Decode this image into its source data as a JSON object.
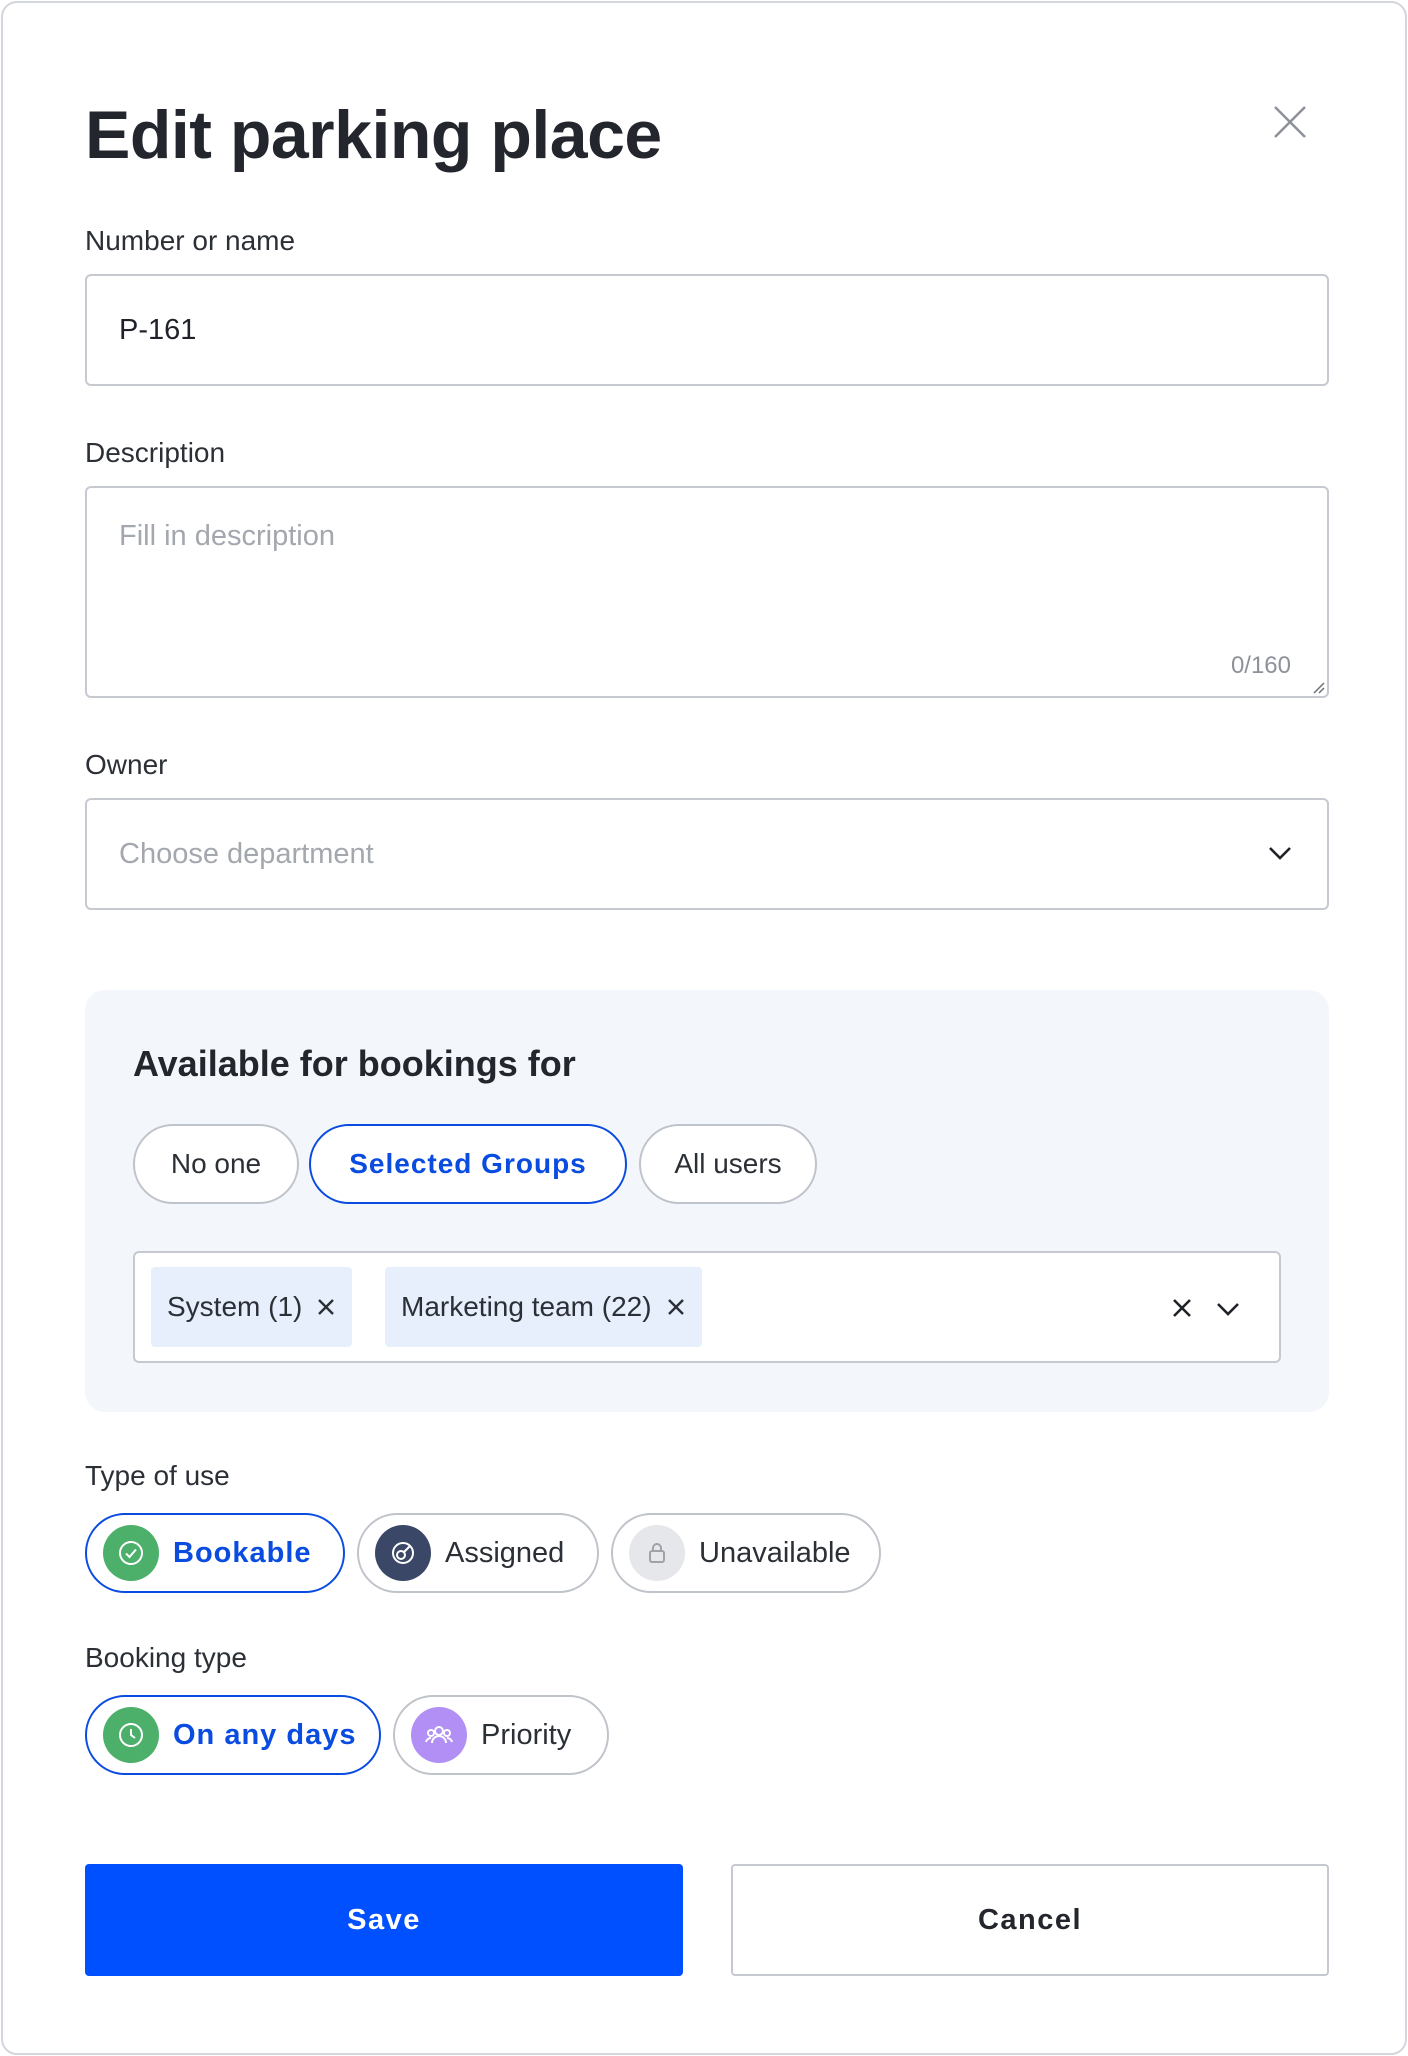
{
  "dialog": {
    "title": "Edit parking place"
  },
  "fields": {
    "name": {
      "label": "Number or name",
      "value": "P-161"
    },
    "description": {
      "label": "Description",
      "placeholder": "Fill in description",
      "counter": "0/160"
    },
    "owner": {
      "label": "Owner",
      "placeholder": "Choose department"
    }
  },
  "availability": {
    "title": "Available for bookings for",
    "options": [
      {
        "label": "No one",
        "selected": false
      },
      {
        "label": "Selected Groups",
        "selected": true
      },
      {
        "label": "All users",
        "selected": false
      }
    ],
    "selected_groups": [
      {
        "label": "System (1)"
      },
      {
        "label": "Marketing team (22)"
      }
    ]
  },
  "type_of_use": {
    "label": "Type of use",
    "options": [
      {
        "label": "Bookable",
        "icon": "check-circle-icon",
        "color": "#4caf6a",
        "selected": true
      },
      {
        "label": "Assigned",
        "icon": "assigned-icon",
        "color": "#3a4766",
        "selected": false
      },
      {
        "label": "Unavailable",
        "icon": "lock-icon",
        "color": "#e6e7ea",
        "selected": false
      }
    ]
  },
  "booking_type": {
    "label": "Booking type",
    "options": [
      {
        "label": "On any days",
        "icon": "clock-icon",
        "color": "#4caf6a",
        "selected": true
      },
      {
        "label": "Priority",
        "icon": "group-icon",
        "color": "#b18ff5",
        "selected": false
      }
    ]
  },
  "actions": {
    "save": "Save",
    "cancel": "Cancel"
  },
  "colors": {
    "accent": "#0050ff",
    "selected_border": "#0a4be0",
    "panel_bg": "#f3f6fb",
    "chip_bg": "#e7effc"
  }
}
